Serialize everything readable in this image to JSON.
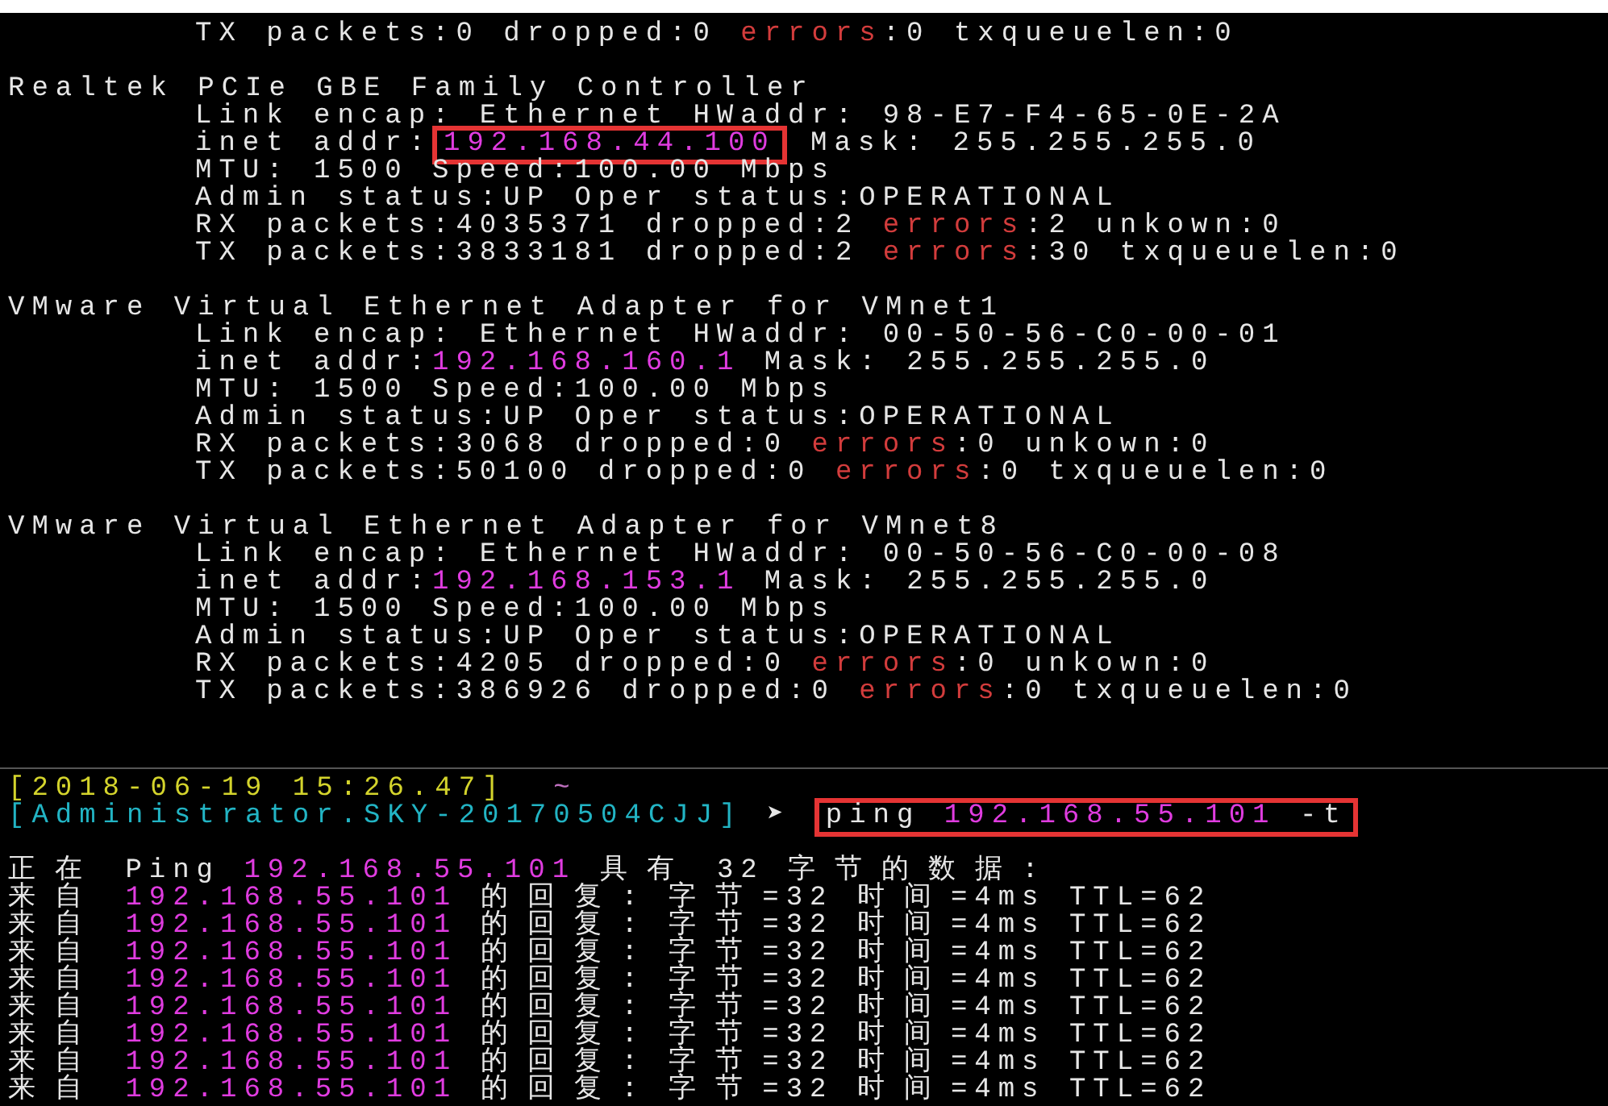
{
  "terminal": {
    "interfaces": [
      {
        "details": [
          {
            "segments": [
              {
                "kind": "plain",
                "text": "TX packets:0 dropped:0 "
              },
              {
                "kind": "error",
                "text": "errors"
              },
              {
                "kind": "plain",
                "text": ":0 txqueuelen:0"
              }
            ]
          }
        ]
      },
      {
        "name": "Realtek PCIe GBE Family Controller",
        "details": [
          {
            "segments": [
              {
                "kind": "plain",
                "text": "Link encap: Ethernet HWaddr: 98-E7-F4-65-0E-2A"
              }
            ]
          },
          {
            "segments": [
              {
                "kind": "plain",
                "text": "inet addr:"
              },
              {
                "kind": "ip",
                "text": "192.168.44.100",
                "boxed": true
              },
              {
                "kind": "plain",
                "text": " Mask: 255.255.255.0"
              }
            ]
          },
          {
            "segments": [
              {
                "kind": "plain",
                "text": "MTU: 1500 Speed:100.00 Mbps"
              }
            ]
          },
          {
            "segments": [
              {
                "kind": "plain",
                "text": "Admin status:UP Oper status:OPERATIONAL"
              }
            ]
          },
          {
            "segments": [
              {
                "kind": "plain",
                "text": "RX packets:4035371 dropped:2 "
              },
              {
                "kind": "error",
                "text": "errors"
              },
              {
                "kind": "plain",
                "text": ":2 unkown:0"
              }
            ]
          },
          {
            "segments": [
              {
                "kind": "plain",
                "text": "TX packets:3833181 dropped:2 "
              },
              {
                "kind": "error",
                "text": "errors"
              },
              {
                "kind": "plain",
                "text": ":30 txqueuelen:0"
              }
            ]
          }
        ]
      },
      {
        "name": "VMware Virtual Ethernet Adapter for VMnet1",
        "details": [
          {
            "segments": [
              {
                "kind": "plain",
                "text": "Link encap: Ethernet HWaddr: 00-50-56-C0-00-01"
              }
            ]
          },
          {
            "segments": [
              {
                "kind": "plain",
                "text": "inet addr:"
              },
              {
                "kind": "ip",
                "text": "192.168.160.1"
              },
              {
                "kind": "plain",
                "text": " Mask: 255.255.255.0"
              }
            ]
          },
          {
            "segments": [
              {
                "kind": "plain",
                "text": "MTU: 1500 Speed:100.00 Mbps"
              }
            ]
          },
          {
            "segments": [
              {
                "kind": "plain",
                "text": "Admin status:UP Oper status:OPERATIONAL"
              }
            ]
          },
          {
            "segments": [
              {
                "kind": "plain",
                "text": "RX packets:3068 dropped:0 "
              },
              {
                "kind": "error",
                "text": "errors"
              },
              {
                "kind": "plain",
                "text": ":0 unkown:0"
              }
            ]
          },
          {
            "segments": [
              {
                "kind": "plain",
                "text": "TX packets:50100 dropped:0 "
              },
              {
                "kind": "error",
                "text": "errors"
              },
              {
                "kind": "plain",
                "text": ":0 txqueuelen:0"
              }
            ]
          }
        ]
      },
      {
        "name": "VMware Virtual Ethernet Adapter for VMnet8",
        "details": [
          {
            "segments": [
              {
                "kind": "plain",
                "text": "Link encap: Ethernet HWaddr: 00-50-56-C0-00-08"
              }
            ]
          },
          {
            "segments": [
              {
                "kind": "plain",
                "text": "inet addr:"
              },
              {
                "kind": "ip",
                "text": "192.168.153.1"
              },
              {
                "kind": "plain",
                "text": " Mask: 255.255.255.0"
              }
            ]
          },
          {
            "segments": [
              {
                "kind": "plain",
                "text": "MTU: 1500 Speed:100.00 Mbps"
              }
            ]
          },
          {
            "segments": [
              {
                "kind": "plain",
                "text": "Admin status:UP Oper status:OPERATIONAL"
              }
            ]
          },
          {
            "segments": [
              {
                "kind": "plain",
                "text": "RX packets:4205 dropped:0 "
              },
              {
                "kind": "error",
                "text": "errors"
              },
              {
                "kind": "plain",
                "text": ":0 unkown:0"
              }
            ]
          },
          {
            "segments": [
              {
                "kind": "plain",
                "text": "TX packets:386926 dropped:0 "
              },
              {
                "kind": "error",
                "text": "errors"
              },
              {
                "kind": "plain",
                "text": ":0 txqueuelen:0"
              }
            ]
          }
        ]
      }
    ],
    "prompt": [
      {
        "segments": [
          {
            "kind": "date",
            "text": "[2018-06-19 15:26.47]"
          },
          {
            "kind": "tilde",
            "text": "  ~"
          }
        ]
      },
      {
        "segments": [
          {
            "kind": "host",
            "text": "[Administrator.SKY-20170504CJJ]"
          },
          {
            "kind": "arrow",
            "text": " ➤ "
          },
          {
            "kind": "plain",
            "text": "ping ",
            "boxed": true
          },
          {
            "kind": "ip",
            "text": "192.168.55.101",
            "boxed": true
          },
          {
            "kind": "plain",
            "text": " -t",
            "boxed": true
          }
        ]
      }
    ],
    "ping_output": [
      {
        "segments": [
          {
            "kind": "plain",
            "text": "正在 Ping "
          },
          {
            "kind": "ip",
            "text": "192.168.55.101"
          },
          {
            "kind": "plain",
            "text": " 具有 32 字节的数据:"
          }
        ]
      },
      {
        "segments": [
          {
            "kind": "plain",
            "text": "来自 "
          },
          {
            "kind": "ip",
            "text": "192.168.55.101"
          },
          {
            "kind": "plain",
            "text": " 的回复: 字节=32 时间=4ms TTL=62"
          }
        ]
      },
      {
        "segments": [
          {
            "kind": "plain",
            "text": "来自 "
          },
          {
            "kind": "ip",
            "text": "192.168.55.101"
          },
          {
            "kind": "plain",
            "text": " 的回复: 字节=32 时间=4ms TTL=62"
          }
        ]
      },
      {
        "segments": [
          {
            "kind": "plain",
            "text": "来自 "
          },
          {
            "kind": "ip",
            "text": "192.168.55.101"
          },
          {
            "kind": "plain",
            "text": " 的回复: 字节=32 时间=4ms TTL=62"
          }
        ]
      },
      {
        "segments": [
          {
            "kind": "plain",
            "text": "来自 "
          },
          {
            "kind": "ip",
            "text": "192.168.55.101"
          },
          {
            "kind": "plain",
            "text": " 的回复: 字节=32 时间=4ms TTL=62"
          }
        ]
      },
      {
        "segments": [
          {
            "kind": "plain",
            "text": "来自 "
          },
          {
            "kind": "ip",
            "text": "192.168.55.101"
          },
          {
            "kind": "plain",
            "text": " 的回复: 字节=32 时间=4ms TTL=62"
          }
        ]
      },
      {
        "segments": [
          {
            "kind": "plain",
            "text": "来自 "
          },
          {
            "kind": "ip",
            "text": "192.168.55.101"
          },
          {
            "kind": "plain",
            "text": " 的回复: 字节=32 时间=4ms TTL=62"
          }
        ]
      },
      {
        "segments": [
          {
            "kind": "plain",
            "text": "来自 "
          },
          {
            "kind": "ip",
            "text": "192.168.55.101"
          },
          {
            "kind": "plain",
            "text": " 的回复: 字节=32 时间=4ms TTL=62"
          }
        ]
      },
      {
        "segments": [
          {
            "kind": "plain",
            "text": "来自 "
          },
          {
            "kind": "ip",
            "text": "192.168.55.101"
          },
          {
            "kind": "plain",
            "text": " 的回复: 字节=32 时间=4ms TTL=62"
          }
        ]
      }
    ]
  }
}
